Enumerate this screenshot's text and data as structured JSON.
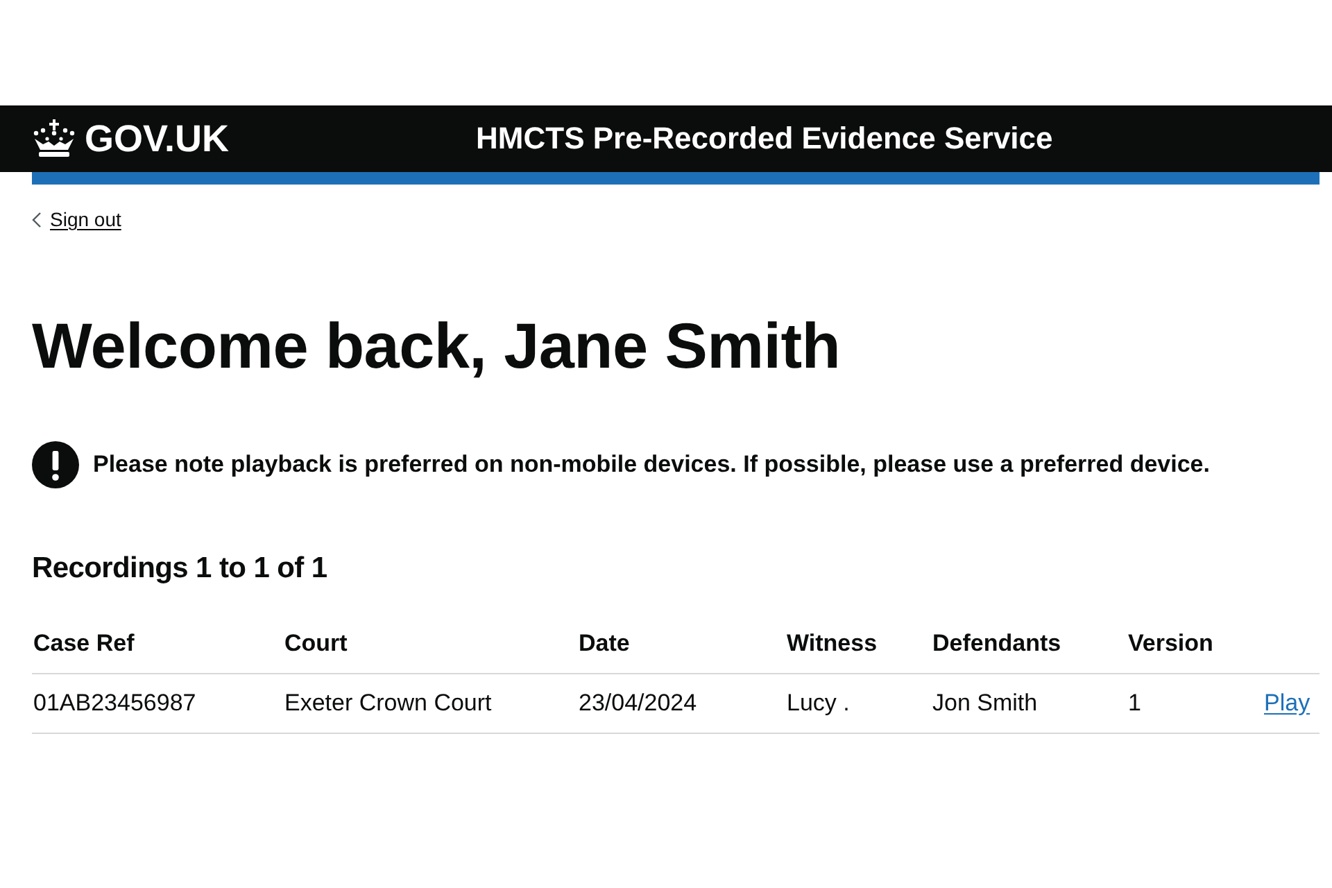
{
  "header": {
    "logo_text": "GOV.UK",
    "service_name": "HMCTS Pre-Recorded Evidence Service"
  },
  "back_link": "Sign out",
  "heading": "Welcome back, Jane Smith",
  "warning": "Please note playback is preferred on non-mobile devices. If possible, please use a preferred device.",
  "table": {
    "caption": "Recordings 1 to 1 of 1",
    "columns": [
      "Case Ref",
      "Court",
      "Date",
      "Witness",
      "Defendants",
      "Version"
    ],
    "rows": [
      {
        "cells": [
          "01AB23456987",
          "Exeter Crown Court",
          "23/04/2024",
          "Lucy .",
          "Jon Smith",
          "1"
        ],
        "action": "Play"
      }
    ]
  }
}
